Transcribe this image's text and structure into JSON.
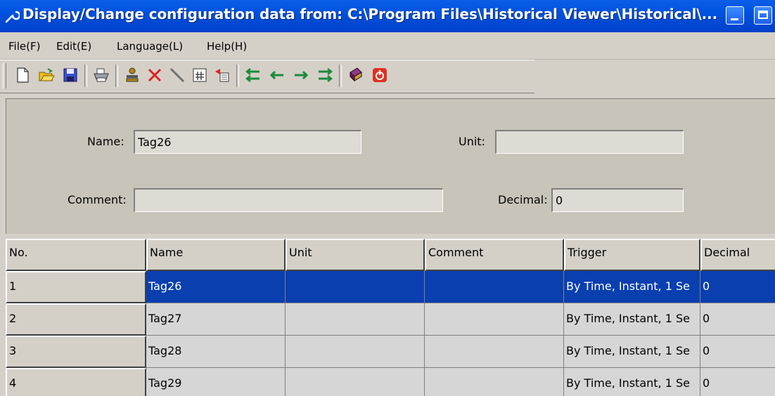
{
  "window": {
    "title": "Display/Change configuration data from: C:\\Program Files\\Historical Viewer\\Historical\\..."
  },
  "menu": {
    "items": [
      {
        "label": "File(F)"
      },
      {
        "label": "Edit(E)"
      },
      {
        "label": "Language(L)"
      },
      {
        "label": "Help(H)"
      }
    ]
  },
  "toolbar": {
    "buttons": [
      "new-icon",
      "open-icon",
      "save-icon",
      "print-icon",
      "tag-group-icon",
      "delete-icon",
      "line-icon",
      "calculator-icon",
      "paste-icon",
      "move-first-icon",
      "move-left-icon",
      "move-right-icon",
      "move-last-icon",
      "book-icon",
      "exit-icon"
    ]
  },
  "form": {
    "name_label": "Name:",
    "name_value": "Tag26",
    "unit_label": "Unit:",
    "unit_value": "",
    "comment_label": "Comment:",
    "comment_value": "",
    "decimal_label": "Decimal:",
    "decimal_value": "0"
  },
  "grid": {
    "columns": [
      "No.",
      "Name",
      "Unit",
      "Comment",
      "Trigger",
      "Decimal"
    ],
    "rows": [
      {
        "no": "1",
        "name": "Tag26",
        "unit": "",
        "comment": "",
        "trigger": "By Time, Instant, 1 Se",
        "decimal": "0",
        "selected": true
      },
      {
        "no": "2",
        "name": "Tag27",
        "unit": "",
        "comment": "",
        "trigger": "By Time, Instant, 1 Se",
        "decimal": "0",
        "selected": false
      },
      {
        "no": "3",
        "name": "Tag28",
        "unit": "",
        "comment": "",
        "trigger": "By Time, Instant, 1 Se",
        "decimal": "0",
        "selected": false
      },
      {
        "no": "4",
        "name": "Tag29",
        "unit": "",
        "comment": "",
        "trigger": "By Time, Instant, 1 Se",
        "decimal": "0",
        "selected": false
      }
    ]
  },
  "colors": {
    "titlebar": "#0052de",
    "selection": "#0a3fb0",
    "background": "#d4d0c8"
  }
}
